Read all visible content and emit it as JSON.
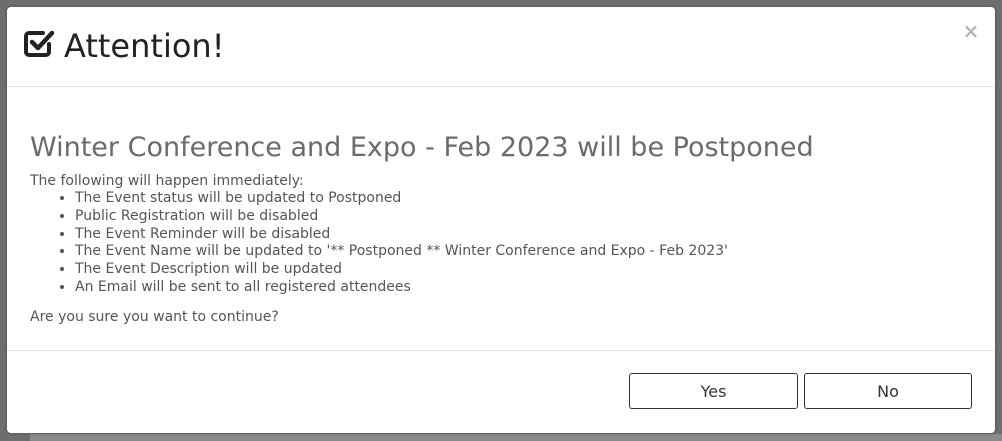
{
  "dialog": {
    "title": "Attention!",
    "close_symbol": "×",
    "header_icon": "checkbox-checked-icon"
  },
  "body": {
    "heading": "Winter Conference and Expo - Feb 2023 will be Postponed",
    "intro": "The following will happen immediately:",
    "items": [
      "The Event status will be updated to Postponed",
      "Public Registration will be disabled",
      "The Event Reminder will be disabled",
      "The Event Name will be updated to '** Postponed ** Winter Conference and Expo - Feb 2023'",
      "The Event Description will be updated",
      "An Email will be sent to all registered attendees"
    ],
    "confirm_question": "Are you sure you want to continue?"
  },
  "footer": {
    "yes_label": "Yes",
    "no_label": "No"
  },
  "colors": {
    "title_text": "#222222",
    "heading_text": "#6b6b6b",
    "body_text": "#555555",
    "backdrop": "#6e6e6e"
  }
}
